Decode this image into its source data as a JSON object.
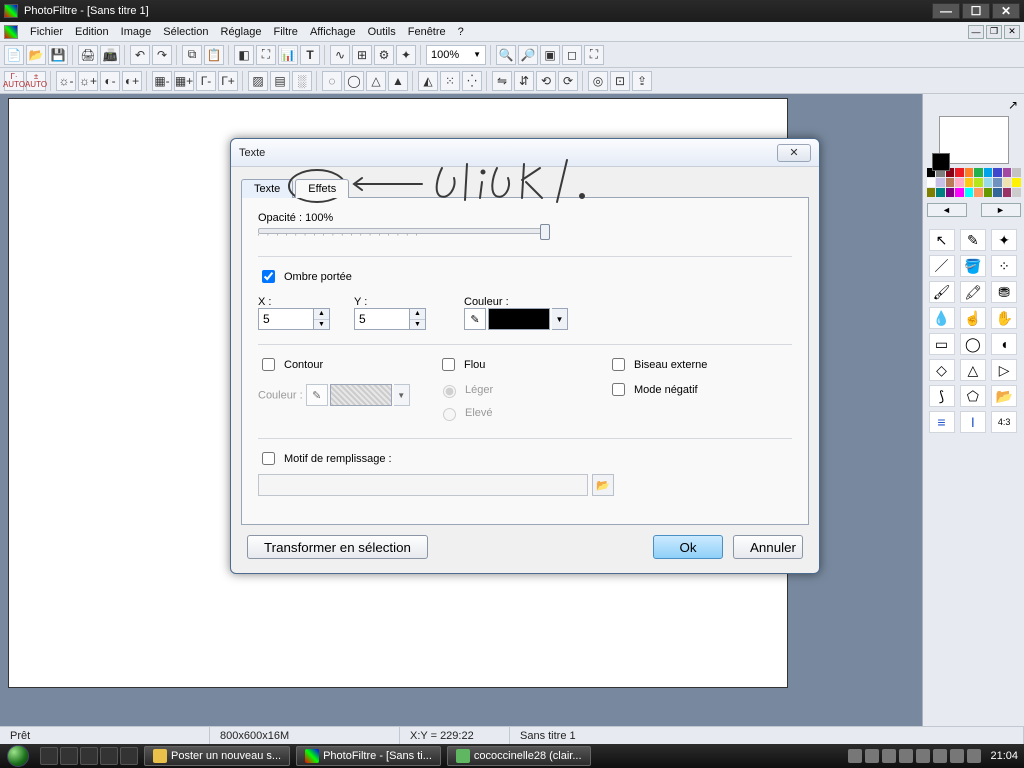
{
  "window": {
    "title": "PhotoFiltre - [Sans titre 1]"
  },
  "menu": {
    "items": [
      "Fichier",
      "Edition",
      "Image",
      "Sélection",
      "Réglage",
      "Filtre",
      "Affichage",
      "Outils",
      "Fenêtre",
      "?"
    ]
  },
  "zoom": "100%",
  "dialog": {
    "title": "Texte",
    "tabs": {
      "texte": "Texte",
      "effets": "Effets"
    },
    "opacity_label": "Opacité : 100%",
    "ombre_label": "Ombre portée",
    "x_label": "X :",
    "y_label": "Y :",
    "x_value": "5",
    "y_value": "5",
    "couleur_label": "Couleur :",
    "contour_label": "Contour",
    "contour_couleur_label": "Couleur :",
    "flou_label": "Flou",
    "leger_label": "Léger",
    "eleve_label": "Elevé",
    "biseau_label": "Biseau externe",
    "negatif_label": "Mode négatif",
    "motif_label": "Motif de remplissage :",
    "transform_btn": "Transformer en sélection",
    "ok_btn": "Ok",
    "cancel_btn": "Annuler"
  },
  "status": {
    "ready": "Prêt",
    "dims": "800x600x16M",
    "coords": "X:Y = 229:22",
    "docname": "Sans titre 1"
  },
  "taskbar": {
    "task1": "Poster un nouveau s...",
    "task2": "PhotoFiltre - [Sans ti...",
    "task3": "cococcinelle28 (clair...",
    "clock": "21:04"
  },
  "palette_colors": [
    "#000000",
    "#7f7f7f",
    "#880015",
    "#ed1c24",
    "#ff7f27",
    "#22b14c",
    "#00a2e8",
    "#3f48cc",
    "#a349a4",
    "#c3c3c3",
    "#ffffff",
    "#c8bfe7",
    "#b97a57",
    "#ffaec9",
    "#ffc90e",
    "#b5e61d",
    "#99d9ea",
    "#7092be",
    "#efe4b0",
    "#fff200",
    "#808000",
    "#008080",
    "#800080",
    "#ff00ff",
    "#00ffff",
    "#ff9966",
    "#669900",
    "#336699",
    "#993366",
    "#cccccc"
  ]
}
